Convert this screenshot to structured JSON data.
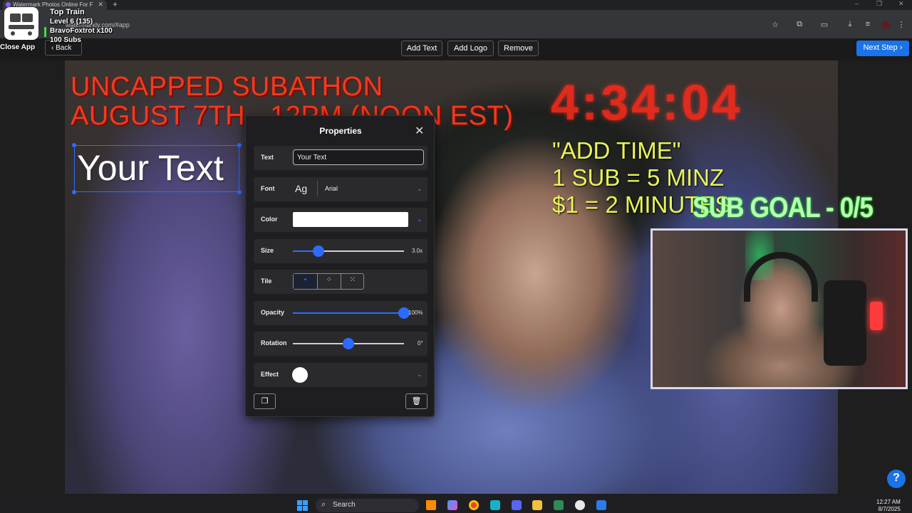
{
  "browser": {
    "tab_title": "Watermark Photos Online For F",
    "url": "watermarkly.com/#app",
    "new_tab_symbol": "+",
    "tab_close_symbol": "✕",
    "window_controls": [
      "–",
      "❐",
      "✕"
    ]
  },
  "stream_overlay": {
    "widget_title": "Top Train",
    "level_line": "Level 6  (135)",
    "top_user_line": "BravoFoxtrot x100",
    "subs_line": "100 Subs",
    "close_app_label": "Close App"
  },
  "toolbar": {
    "back_label": "Back",
    "add_text_label": "Add Text",
    "add_logo_label": "Add Logo",
    "remove_label": "Remove",
    "next_step_label": "Next Step"
  },
  "canvas": {
    "banner_line_1": "UNCAPPED SUBATHON",
    "banner_line_2": "AUGUST 7TH - 12PM (NOON EST)",
    "timer": "4:34:04",
    "add_time_line_1": "\"ADD TIME\"",
    "add_time_line_2": "1 SUB = 5 MINZ",
    "add_time_line_3": "$1 = 2 MINUTES",
    "sub_goal": "SUB GOAL - 0/5",
    "watermark_text": "Your Text"
  },
  "properties": {
    "title": "Properties",
    "text_label": "Text",
    "text_value": "Your Text",
    "font_label": "Font",
    "font_preview": "Ag",
    "font_name": "Arial",
    "color_label": "Color",
    "color_value": "#ffffff",
    "size_label": "Size",
    "size_value": "3.0x",
    "size_fraction": 0.23,
    "tile_label": "Tile",
    "tile_options": [
      "single",
      "grid",
      "diagonal"
    ],
    "tile_selected": "single",
    "opacity_label": "Opacity",
    "opacity_value": "100%",
    "opacity_fraction": 1.0,
    "rotation_label": "Rotation",
    "rotation_value": "0°",
    "rotation_fraction": 0.5,
    "effect_label": "Effect"
  },
  "taskbar": {
    "search_placeholder": "Search",
    "time": "12:27 AM",
    "date": "8/7/2025"
  },
  "colors": {
    "accent": "#1a73e8",
    "slider": "#2d6bff",
    "banner_red": "#f23a1f",
    "add_time_yellow": "#e8f25a",
    "sub_goal_green": "#b8ffb0"
  },
  "help_symbol": "?"
}
